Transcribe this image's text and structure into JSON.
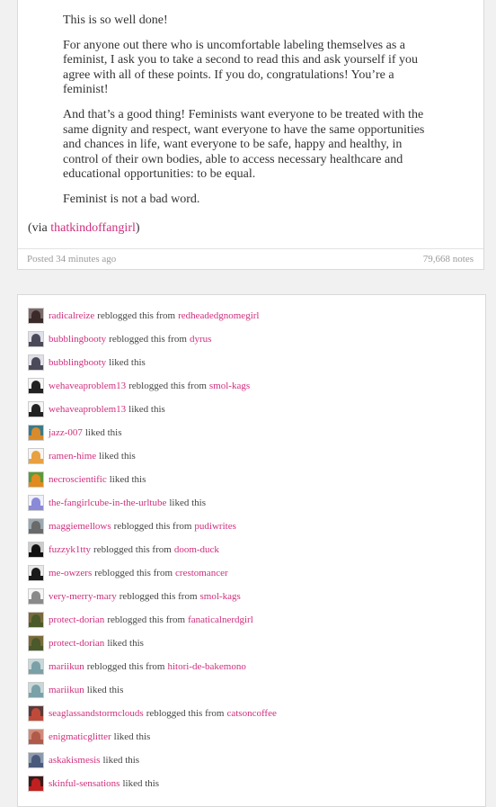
{
  "post": {
    "paragraphs": [
      "This is so well done!",
      "For anyone out there who is uncomfortable labeling themselves as a feminist, I ask you to take a second to read this and ask yourself if you agree with all of these points. If you do, congratulations! You’re a feminist!",
      "And that’s a good thing! Feminists want everyone to be treated with the same dignity and respect, want everyone to have the same opportunities and chances in life, want everyone to be safe, happy and healthy, in control of their own bodies, able to access necessary healthcare and educational opportunities: to be equal.",
      "Feminist is not a bad word."
    ],
    "via_prefix": "(via ",
    "via_user": "thatkindoffangirl",
    "via_suffix": ")",
    "posted": "Posted 34 minutes ago",
    "notes_count": "79,668 notes"
  },
  "notes": [
    {
      "user": "radicalreize",
      "action": "reblogged this from",
      "source": "redheadedgnomegirl",
      "avatar_colors": [
        "#3a2a2a",
        "#7a6a6a"
      ]
    },
    {
      "user": "bubblingbooty",
      "action": "reblogged this from",
      "source": "dyrus",
      "avatar_colors": [
        "#4a4a5a",
        "#e0e0e8"
      ]
    },
    {
      "user": "bubblingbooty",
      "action": "liked this",
      "source": "",
      "avatar_colors": [
        "#4a4a5a",
        "#e0e0e8"
      ]
    },
    {
      "user": "wehaveaproblem13",
      "action": "reblogged this from",
      "source": "smol-kags",
      "avatar_colors": [
        "#222222",
        "#f5f5f5"
      ]
    },
    {
      "user": "wehaveaproblem13",
      "action": "liked this",
      "source": "",
      "avatar_colors": [
        "#222222",
        "#f5f5f5"
      ]
    },
    {
      "user": "jazz-007",
      "action": "liked this",
      "source": "",
      "avatar_colors": [
        "#d98a2a",
        "#3a7a8a"
      ]
    },
    {
      "user": "ramen-hime",
      "action": "liked this",
      "source": "",
      "avatar_colors": [
        "#e8a040",
        "#f5f5f5"
      ]
    },
    {
      "user": "necroscientific",
      "action": "liked this",
      "source": "",
      "avatar_colors": [
        "#e08a20",
        "#5a9a3a"
      ]
    },
    {
      "user": "the-fangirlcube-in-the-urltube",
      "action": "liked this",
      "source": "",
      "avatar_colors": [
        "#8a8ad8",
        "#f0f0ff"
      ]
    },
    {
      "user": "maggiemellows",
      "action": "reblogged this from",
      "source": "pudiwrites",
      "avatar_colors": [
        "#6a6a6a",
        "#9aa8b0"
      ]
    },
    {
      "user": "fuzzyk1tty",
      "action": "reblogged this from",
      "source": "doom-duck",
      "avatar_colors": [
        "#111111",
        "#cccccc"
      ]
    },
    {
      "user": "me-owzers",
      "action": "reblogged this from",
      "source": "crestomancer",
      "avatar_colors": [
        "#1a1a1a",
        "#e8e8e8"
      ]
    },
    {
      "user": "very-merry-mary",
      "action": "reblogged this from",
      "source": "smol-kags",
      "avatar_colors": [
        "#8a8a8a",
        "#f5f5f5"
      ]
    },
    {
      "user": "protect-dorian",
      "action": "reblogged this from",
      "source": "fanaticalnerdgirl",
      "avatar_colors": [
        "#4a5a2a",
        "#7a6a3a"
      ]
    },
    {
      "user": "protect-dorian",
      "action": "liked this",
      "source": "",
      "avatar_colors": [
        "#4a5a2a",
        "#7a6a3a"
      ]
    },
    {
      "user": "mariikun",
      "action": "reblogged this from",
      "source": "hitori-de-bakemono",
      "avatar_colors": [
        "#7aa0a8",
        "#c8d8d8"
      ]
    },
    {
      "user": "mariikun",
      "action": "liked this",
      "source": "",
      "avatar_colors": [
        "#7aa0a8",
        "#c8d8d8"
      ]
    },
    {
      "user": "seaglassandstormclouds",
      "action": "reblogged this from",
      "source": "catsoncoffee",
      "avatar_colors": [
        "#c04a3a",
        "#5a3a3a"
      ]
    },
    {
      "user": "enigmaticglitter",
      "action": "liked this",
      "source": "",
      "avatar_colors": [
        "#b05a4a",
        "#d08a7a"
      ]
    },
    {
      "user": "askakismesis",
      "action": "liked this",
      "source": "",
      "avatar_colors": [
        "#4a5a7a",
        "#8a9ab0"
      ]
    },
    {
      "user": "skinful-sensations",
      "action": "liked this",
      "source": "",
      "avatar_colors": [
        "#c02020",
        "#3a1a1a"
      ]
    }
  ]
}
